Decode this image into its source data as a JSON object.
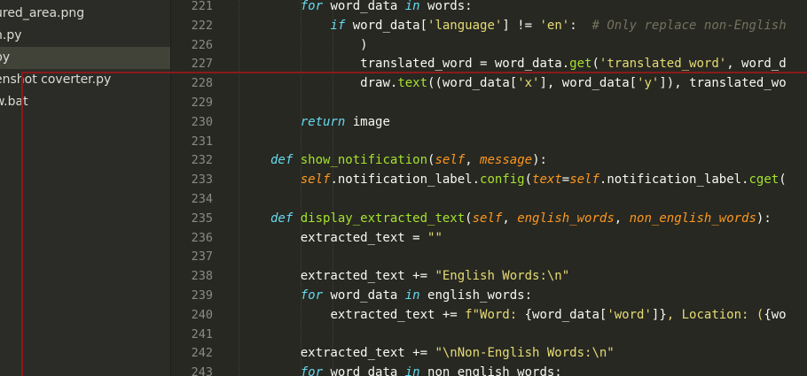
{
  "sidebar": {
    "items": [
      {
        "label": "ured_area.png",
        "selected": false
      },
      {
        "label": "n.py",
        "selected": false
      },
      {
        "label": "py",
        "selected": true
      },
      {
        "label": "enshot coverter.py",
        "selected": false
      },
      {
        "label": "w.bat",
        "selected": false
      }
    ]
  },
  "editor": {
    "lines": [
      {
        "no": "221",
        "indent": 1,
        "tokens": [
          [
            "kw",
            "for"
          ],
          [
            "pl",
            " word_data "
          ],
          [
            "kw",
            "in"
          ],
          [
            "pl",
            " words:"
          ]
        ]
      },
      {
        "no": "222",
        "indent": 2,
        "tokens": [
          [
            "kw",
            "if"
          ],
          [
            "pl",
            " word_data["
          ],
          [
            "str",
            "'language'"
          ],
          [
            "pl",
            "] != "
          ],
          [
            "str",
            "'en'"
          ],
          [
            "pl",
            ":  "
          ],
          [
            "cm",
            "# Only replace non-English"
          ]
        ]
      },
      {
        "no": "226",
        "indent": 3,
        "tokens": [
          [
            "pl",
            ")"
          ]
        ]
      },
      {
        "no": "227",
        "indent": 3,
        "tokens": [
          [
            "pl",
            "translated_word = word_data."
          ],
          [
            "call",
            "get"
          ],
          [
            "pl",
            "("
          ],
          [
            "str",
            "'translated_word'"
          ],
          [
            "pl",
            ", word_d"
          ]
        ]
      },
      {
        "no": "228",
        "indent": 3,
        "tokens": [
          [
            "pl",
            "draw."
          ],
          [
            "call",
            "text"
          ],
          [
            "pl",
            "((word_data["
          ],
          [
            "str",
            "'x'"
          ],
          [
            "pl",
            "], word_data["
          ],
          [
            "str",
            "'y'"
          ],
          [
            "pl",
            "]), translated_wo"
          ]
        ]
      },
      {
        "no": "229",
        "indent": 0,
        "tokens": []
      },
      {
        "no": "230",
        "indent": 1,
        "tokens": [
          [
            "kw",
            "return"
          ],
          [
            "pl",
            " image"
          ]
        ]
      },
      {
        "no": "231",
        "indent": 0,
        "tokens": []
      },
      {
        "no": "232",
        "indent": 0,
        "tokens": [
          [
            "def",
            "def"
          ],
          [
            "pl",
            " "
          ],
          [
            "fn",
            "show_notification"
          ],
          [
            "pl",
            "("
          ],
          [
            "self",
            "self"
          ],
          [
            "pl",
            ", "
          ],
          [
            "par",
            "message"
          ],
          [
            "pl",
            "):"
          ]
        ]
      },
      {
        "no": "233",
        "indent": 1,
        "tokens": [
          [
            "self",
            "self"
          ],
          [
            "pl",
            ".notification_label."
          ],
          [
            "call",
            "config"
          ],
          [
            "pl",
            "("
          ],
          [
            "par",
            "text"
          ],
          [
            "pl",
            "="
          ],
          [
            "self",
            "self"
          ],
          [
            "pl",
            ".notification_label."
          ],
          [
            "call",
            "cget"
          ],
          [
            "pl",
            "("
          ]
        ]
      },
      {
        "no": "234",
        "indent": 0,
        "tokens": []
      },
      {
        "no": "235",
        "indent": 0,
        "tokens": [
          [
            "def",
            "def"
          ],
          [
            "pl",
            " "
          ],
          [
            "fn",
            "display_extracted_text"
          ],
          [
            "pl",
            "("
          ],
          [
            "self",
            "self"
          ],
          [
            "pl",
            ", "
          ],
          [
            "par",
            "english_words"
          ],
          [
            "pl",
            ", "
          ],
          [
            "par",
            "non_english_words"
          ],
          [
            "pl",
            "):"
          ]
        ]
      },
      {
        "no": "236",
        "indent": 1,
        "tokens": [
          [
            "pl",
            "extracted_text = "
          ],
          [
            "str",
            "\"\""
          ]
        ]
      },
      {
        "no": "237",
        "indent": 0,
        "tokens": []
      },
      {
        "no": "238",
        "indent": 1,
        "tokens": [
          [
            "pl",
            "extracted_text += "
          ],
          [
            "str",
            "\"English Words:\\n\""
          ]
        ]
      },
      {
        "no": "239",
        "indent": 1,
        "tokens": [
          [
            "kw",
            "for"
          ],
          [
            "pl",
            " word_data "
          ],
          [
            "kw",
            "in"
          ],
          [
            "pl",
            " english_words:"
          ]
        ]
      },
      {
        "no": "240",
        "indent": 2,
        "tokens": [
          [
            "pl",
            "extracted_text += "
          ],
          [
            "str",
            "f\"Word: "
          ],
          [
            "pl",
            "{word_data["
          ],
          [
            "str",
            "'word'"
          ],
          [
            "pl",
            "]}"
          ],
          [
            "str",
            ", Location: ("
          ],
          [
            "pl",
            "{wo"
          ]
        ]
      },
      {
        "no": "241",
        "indent": 0,
        "tokens": []
      },
      {
        "no": "242",
        "indent": 1,
        "tokens": [
          [
            "pl",
            "extracted_text += "
          ],
          [
            "str",
            "\"\\nNon-English Words:\\n\""
          ]
        ]
      },
      {
        "no": "243",
        "indent": 1,
        "tokens": [
          [
            "kw",
            "for"
          ],
          [
            "pl",
            " word_data "
          ],
          [
            "kw",
            "in"
          ],
          [
            "pl",
            " non_english_words:"
          ]
        ]
      }
    ]
  },
  "colors": {
    "background": "#272822",
    "sidebar": "#2b2c27",
    "keyword": "#66d9ef",
    "string": "#e6db74",
    "function": "#a6e22e",
    "parameter": "#fd971f",
    "comment": "#75715e",
    "selection_rect": "#8b1a1a"
  }
}
